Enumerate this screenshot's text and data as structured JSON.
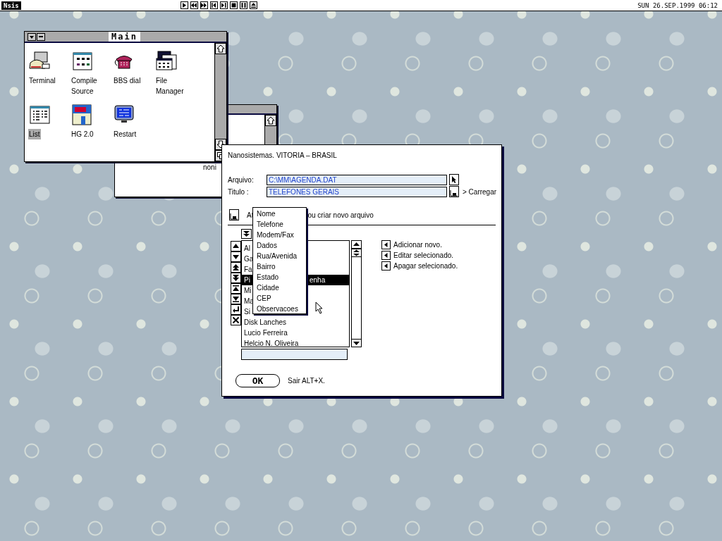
{
  "menu_bar": {
    "logo": "Nsis",
    "clock": "SUN 26.SEP.1999 06:12"
  },
  "background_window": {
    "text": "noni"
  },
  "main_window": {
    "title": "Main",
    "icons": [
      {
        "label": "Terminal",
        "kind": "terminal",
        "selected": false
      },
      {
        "label": "Compile Source",
        "kind": "compiler",
        "selected": false
      },
      {
        "label": "BBS dial",
        "kind": "phone",
        "selected": false
      },
      {
        "label": "File Manager",
        "kind": "file-manager",
        "selected": false
      },
      {
        "label": "List",
        "kind": "list",
        "selected": true
      },
      {
        "label": "HG 2.0",
        "kind": "hg",
        "selected": false
      },
      {
        "label": "Restart",
        "kind": "monitor",
        "selected": false
      }
    ]
  },
  "dialog": {
    "header": "Nanosistemas. VITORIA – BRASIL",
    "fields": [
      {
        "label": "Arquivo:",
        "value": "C:\\MM\\AGENDA.DAT",
        "kind": "pointer"
      },
      {
        "label": "Titulo :",
        "value": "TELEFONES GERAIS",
        "kind": "disk",
        "action": "> Carregar"
      }
    ],
    "update_text_start": "At",
    "update_text_end": "ou criar novo arquivo",
    "list_rows": [
      {
        "text": "Al",
        "selected": false
      },
      {
        "text": "Ga",
        "selected": false
      },
      {
        "text": "Fa",
        "selected": false
      },
      {
        "text": "Pi",
        "tail": "enha",
        "selected": true
      },
      {
        "text": "Mi",
        "selected": false
      },
      {
        "text": "Ma",
        "selected": false
      },
      {
        "text": "Si",
        "selected": false
      },
      {
        "text": "Disk Lanches",
        "selected": false
      },
      {
        "text": "Lucio Ferreira",
        "selected": false
      },
      {
        "text": "Helcio N. Oliveira",
        "selected": false
      }
    ],
    "actions": [
      "Adicionar novo.",
      "Editar selecionado.",
      "Apagar selecionado."
    ],
    "ok": "OK",
    "exit_hint": "Sair ALT+X.",
    "dropdown": [
      "Nome",
      "Telefone",
      "Modem/Fax",
      "Dados",
      "Rua/Avenida",
      "Bairro",
      "Estado",
      "Cidade",
      "CEP",
      "Observacoes"
    ]
  }
}
